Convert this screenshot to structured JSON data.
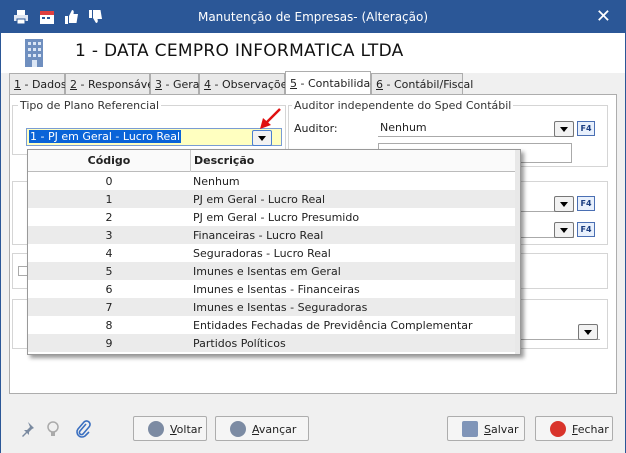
{
  "window": {
    "title": "Manutenção de Empresas- (Alteração)"
  },
  "header": {
    "company": "1 - DATA CEMPRO INFORMATICA LTDA"
  },
  "tabs": [
    {
      "key": "1",
      "label": " - Dados"
    },
    {
      "key": "2",
      "label": " - Responsável"
    },
    {
      "key": "3",
      "label": " - Geral"
    },
    {
      "key": "4",
      "label": " - Observações"
    },
    {
      "key": "5",
      "label": " - Contabilidade"
    },
    {
      "key": "6",
      "label": " - Contábil/Fiscal"
    }
  ],
  "plano": {
    "title": "Tipo de Plano Referencial",
    "value": "1 - PJ em Geral - Lucro Real"
  },
  "auditor": {
    "title": "Auditor independente do Sped Contábil",
    "label": "Auditor:",
    "value": "Nenhum",
    "f4": "F4"
  },
  "f4": "F4",
  "dropdown": {
    "col_code": "Código",
    "col_desc": "Descrição",
    "rows": [
      {
        "code": "0",
        "desc": "Nenhum"
      },
      {
        "code": "1",
        "desc": "PJ em Geral - Lucro Real"
      },
      {
        "code": "2",
        "desc": "PJ em Geral - Lucro Presumido"
      },
      {
        "code": "3",
        "desc": "Financeiras - Lucro Real"
      },
      {
        "code": "4",
        "desc": "Seguradoras - Lucro Real"
      },
      {
        "code": "5",
        "desc": "Imunes e Isentas em Geral"
      },
      {
        "code": "6",
        "desc": "Imunes e Isentas - Financeiras"
      },
      {
        "code": "7",
        "desc": "Imunes e Isentas - Seguradoras"
      },
      {
        "code": "8",
        "desc": "Entidades Fechadas de Previdência Complementar"
      },
      {
        "code": "9",
        "desc": "Partidos Políticos"
      }
    ]
  },
  "footer": {
    "voltar_key": "V",
    "voltar_rest": "oltar",
    "avancar_key": "A",
    "avancar_rest": "vançar",
    "salvar_key": "S",
    "salvar_rest": "alvar",
    "fechar_key": "F",
    "fechar_rest": "echar"
  }
}
